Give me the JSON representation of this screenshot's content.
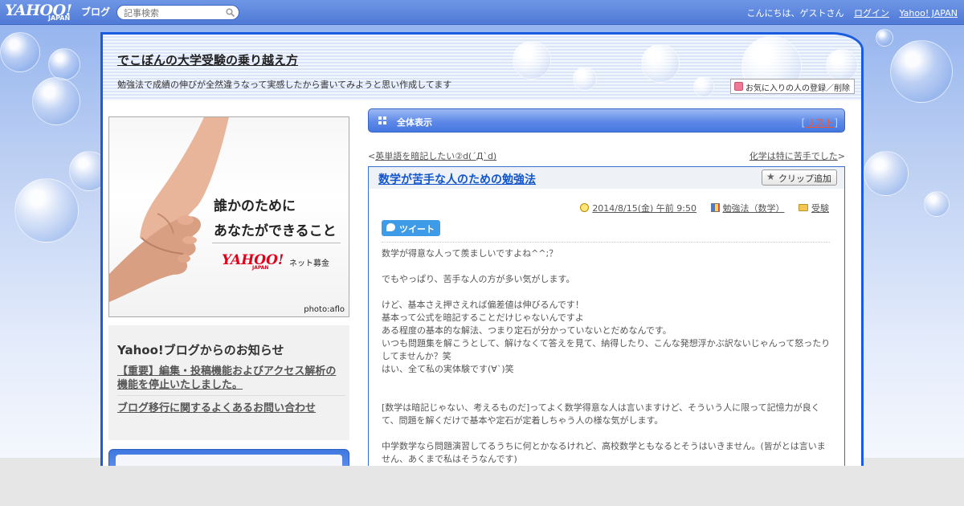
{
  "topbar": {
    "logo": "YAHOO!",
    "logo_sub": "JAPAN",
    "logo_blog": "ブログ",
    "search_placeholder": "記事検索",
    "greeting": "こんにちは、ゲストさん",
    "login_label": "ログイン",
    "yahoo_japan_label": "Yahoo! JAPAN"
  },
  "blog": {
    "title": "でこぼんの大学受験の乗り越え方",
    "description": "勉強法で成績の伸びが全然違うなって実感したから書いてみようと思い作成してます",
    "favorite_button": "お気に入りの人の登録／削除"
  },
  "ad": {
    "line1": "誰かのために",
    "line2": "あなたができること",
    "logo": "YAHOO!",
    "logo_sub": "JAPAN",
    "brand": "ネット募金",
    "credit": "photo:aflo"
  },
  "news": {
    "title": "Yahoo!ブログからのお知らせ",
    "links": [
      "【重要】編集・投稿機能およびアクセス解析の機能を停止いたしました。",
      "ブログ移行に関するよくあるお問い合わせ"
    ]
  },
  "section": {
    "label": "全体表示",
    "bracket_open": "[",
    "list_link": "リスト",
    "bracket_close": "]"
  },
  "nav": {
    "prev_arrow": "<",
    "prev_label": "英単語を暗記したい②d(´Д`d)",
    "next_label": "化学は特に苦手でした",
    "next_arrow": ">"
  },
  "article": {
    "title": "数学が苦手な人のための勉強法",
    "clip_button": "クリップ追加",
    "date": "2014/8/15(金) 午前 9:50",
    "category": "勉強法（数学）",
    "folder": "受験",
    "tweet_button": "ツイート",
    "body": [
      "数学が得意な人って羨ましいですよね^^;？",
      "",
      "でもやっぱり、苦手な人の方が多い気がします。",
      "",
      "けど、基本さえ押さえれば偏差値は伸びるんです！",
      "基本って公式を暗記することだけじゃないんですよ",
      "ある程度の基本的な解法、つまり定石が分かっていないとだめなんです。",
      "いつも問題集を解こうとして、解けなくて答えを見て、納得したり、こんな発想浮かぶ訳ないじゃんって怒ったりしてませんか？笑",
      "はい、全て私の実体験です(∀`)笑",
      "",
      "",
      "[数学は暗記じゃない、考えるものだ]ってよく数学得意な人は言いますけど、そういう人に限って記憶力が良くて、問題を解くだけで基本や定石が定着しちゃう人の様な気がします。",
      "",
      "中学数学なら問題演習してるうちに何とかなるけれど、高校数学ともなるとそうはいきません。(皆がとは言いません、あくまで私はそうなんです)"
    ]
  },
  "colors": {
    "frame_border": "#1a5be0",
    "article_title": "#1155cc",
    "list_link": "#ff5522",
    "tweet": "#3d9be8"
  }
}
